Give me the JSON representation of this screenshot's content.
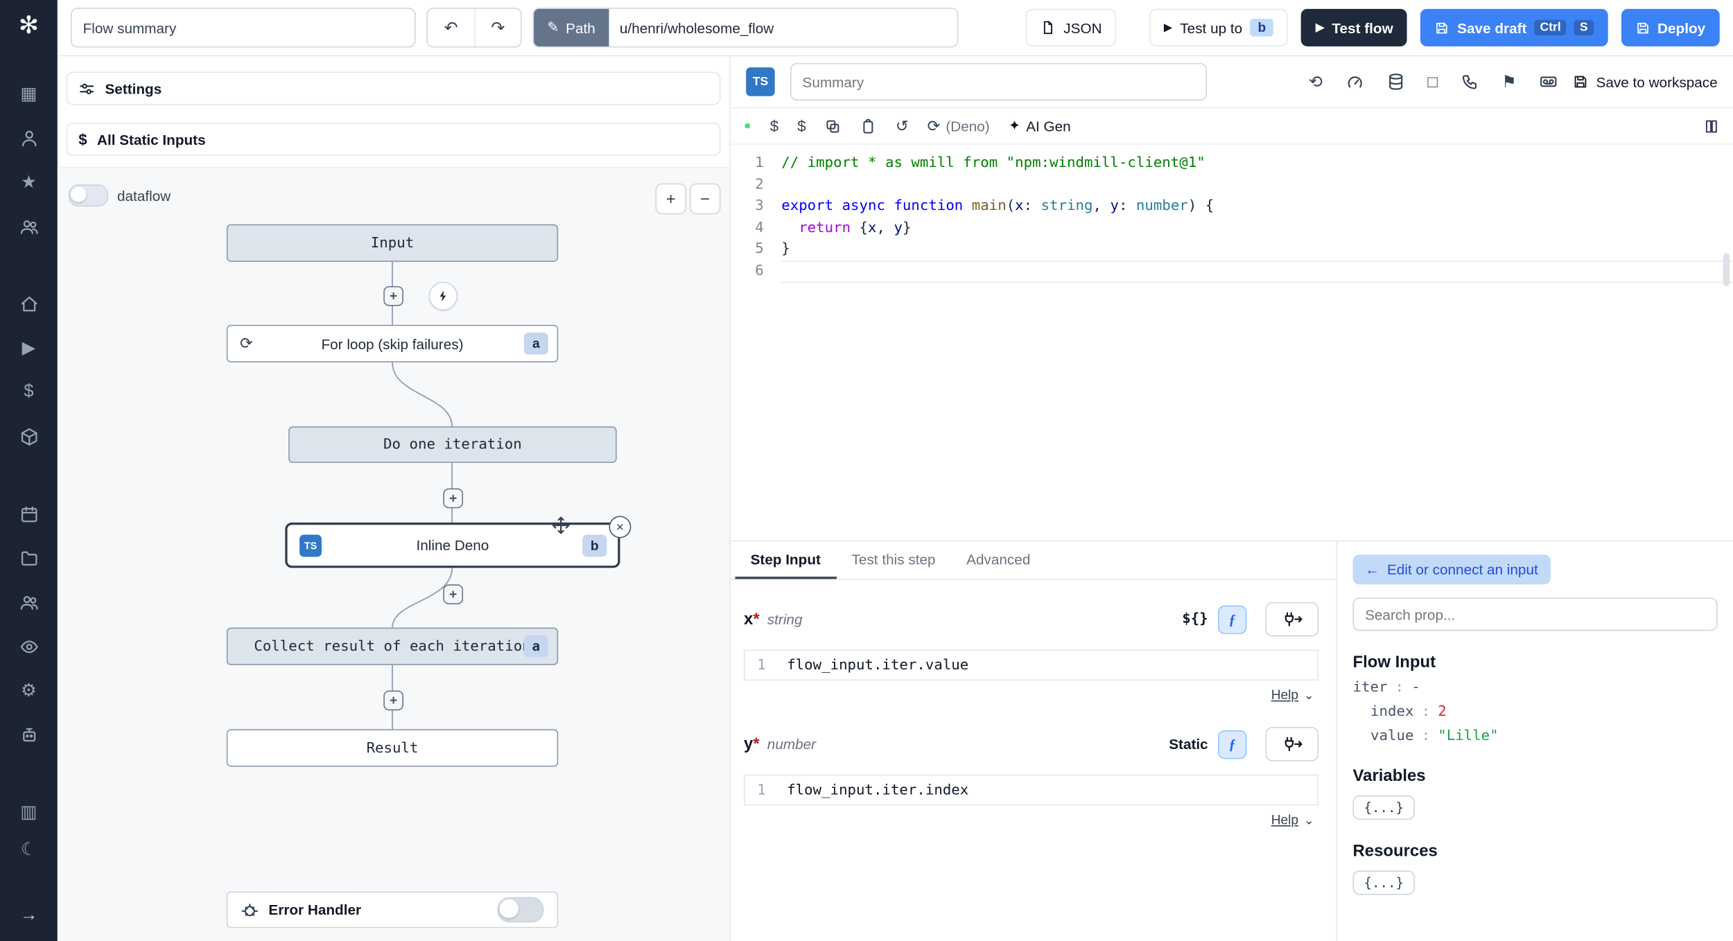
{
  "icons": {
    "logo": "✻",
    "grid": "▦",
    "star": "★",
    "play": "▶",
    "dollar": "$",
    "gear": "⚙",
    "moon": "☾",
    "arrow_right": "→",
    "columns": "▥",
    "undo": "↶",
    "redo": "↷",
    "pencil": "✎",
    "refresh": "⟲",
    "reload": "⟳",
    "undo_circle": "↺",
    "sparkle": "✦",
    "dot": "●",
    "flag": "⚑",
    "square": "□",
    "caret": "⌄",
    "plus": "+",
    "minus": "−",
    "close": "×",
    "loop": "⟳",
    "back_arrow": "←"
  },
  "topbar": {
    "flow_summary": "Flow summary",
    "path_label": "Path",
    "path_value": "u/henri/wholesome_flow",
    "json_label": "JSON",
    "test_up_to_label": "Test up to",
    "test_up_to_badge": "b",
    "test_flow_label": "Test flow",
    "save_draft_label": "Save draft",
    "kbd_ctrl": "Ctrl",
    "kbd_s": "S",
    "deploy_label": "Deploy"
  },
  "flow_panel": {
    "settings_label": "Settings",
    "static_inputs_label": "All Static Inputs",
    "dataflow_label": "dataflow",
    "nodes": {
      "input": "Input",
      "for_loop": "For loop (skip failures)",
      "for_loop_badge": "a",
      "do_iteration": "Do one iteration",
      "inline_lang": "TS",
      "inline": "Inline Deno",
      "inline_badge": "b",
      "collect": "Collect result of each iteration",
      "collect_badge": "a",
      "result": "Result"
    },
    "error_handler_label": "Error Handler"
  },
  "editor": {
    "lang_badge": "TS",
    "summary_placeholder": "Summary",
    "save_to_workspace": "Save to workspace",
    "deno_label": "(Deno)",
    "ai_gen_label": "AI Gen",
    "lines": [
      [
        [
          "// import * as wmill from \"npm:windmill-client@1\"",
          "cm"
        ]
      ],
      [],
      [
        [
          "export async function ",
          "kw"
        ],
        [
          "main",
          "fn"
        ],
        [
          "(",
          "pl"
        ],
        [
          "x",
          "vr"
        ],
        [
          ": ",
          "pl"
        ],
        [
          "string",
          "ty"
        ],
        [
          ", ",
          "pl"
        ],
        [
          "y",
          "vr"
        ],
        [
          ": ",
          "pl"
        ],
        [
          "number",
          "ty"
        ],
        [
          ") {",
          "pl"
        ]
      ],
      [
        [
          "  ",
          "pl"
        ],
        [
          "return",
          "kw2"
        ],
        [
          " {",
          "pl"
        ],
        [
          "x",
          "vr"
        ],
        [
          ", ",
          "pl"
        ],
        [
          "y",
          "vr"
        ],
        [
          "}",
          "pl"
        ]
      ],
      [
        [
          "}",
          "pl"
        ]
      ],
      []
    ]
  },
  "step_panel": {
    "tabs": [
      "Step Input",
      "Test this step",
      "Advanced"
    ],
    "inputs": [
      {
        "name": "x",
        "star": "*",
        "type": "string",
        "mode": "${}",
        "line_no": "1",
        "code": "flow_input.iter.value",
        "help": "Help"
      },
      {
        "name": "y",
        "star": "*",
        "type": "number",
        "mode": "Static",
        "line_no": "1",
        "code": "flow_input.iter.index",
        "help": "Help"
      }
    ]
  },
  "connect_panel": {
    "back_label": "Edit or connect an input",
    "search_placeholder": "Search prop...",
    "flow_input_title": "Flow Input",
    "props": [
      {
        "key": "iter",
        "sep": ":",
        "value": "-"
      },
      {
        "key": "index",
        "sep": ":",
        "value": "2"
      },
      {
        "key": "value",
        "sep": ":",
        "value": "\"Lille\""
      }
    ],
    "variables_title": "Variables",
    "resources_title": "Resources",
    "object_chip": "{...}"
  }
}
